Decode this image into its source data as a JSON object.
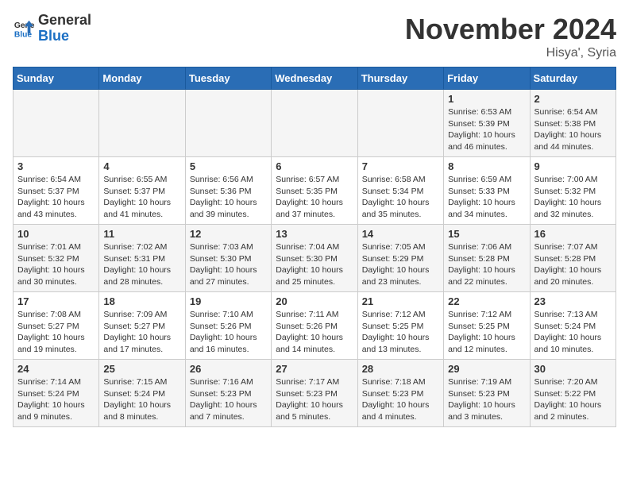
{
  "header": {
    "logo_line1": "General",
    "logo_line2": "Blue",
    "month": "November 2024",
    "location": "Hisya', Syria"
  },
  "days_of_week": [
    "Sunday",
    "Monday",
    "Tuesday",
    "Wednesday",
    "Thursday",
    "Friday",
    "Saturday"
  ],
  "weeks": [
    [
      {
        "day": "",
        "info": ""
      },
      {
        "day": "",
        "info": ""
      },
      {
        "day": "",
        "info": ""
      },
      {
        "day": "",
        "info": ""
      },
      {
        "day": "",
        "info": ""
      },
      {
        "day": "1",
        "info": "Sunrise: 6:53 AM\nSunset: 5:39 PM\nDaylight: 10 hours and 46 minutes."
      },
      {
        "day": "2",
        "info": "Sunrise: 6:54 AM\nSunset: 5:38 PM\nDaylight: 10 hours and 44 minutes."
      }
    ],
    [
      {
        "day": "3",
        "info": "Sunrise: 6:54 AM\nSunset: 5:37 PM\nDaylight: 10 hours and 43 minutes."
      },
      {
        "day": "4",
        "info": "Sunrise: 6:55 AM\nSunset: 5:37 PM\nDaylight: 10 hours and 41 minutes."
      },
      {
        "day": "5",
        "info": "Sunrise: 6:56 AM\nSunset: 5:36 PM\nDaylight: 10 hours and 39 minutes."
      },
      {
        "day": "6",
        "info": "Sunrise: 6:57 AM\nSunset: 5:35 PM\nDaylight: 10 hours and 37 minutes."
      },
      {
        "day": "7",
        "info": "Sunrise: 6:58 AM\nSunset: 5:34 PM\nDaylight: 10 hours and 35 minutes."
      },
      {
        "day": "8",
        "info": "Sunrise: 6:59 AM\nSunset: 5:33 PM\nDaylight: 10 hours and 34 minutes."
      },
      {
        "day": "9",
        "info": "Sunrise: 7:00 AM\nSunset: 5:32 PM\nDaylight: 10 hours and 32 minutes."
      }
    ],
    [
      {
        "day": "10",
        "info": "Sunrise: 7:01 AM\nSunset: 5:32 PM\nDaylight: 10 hours and 30 minutes."
      },
      {
        "day": "11",
        "info": "Sunrise: 7:02 AM\nSunset: 5:31 PM\nDaylight: 10 hours and 28 minutes."
      },
      {
        "day": "12",
        "info": "Sunrise: 7:03 AM\nSunset: 5:30 PM\nDaylight: 10 hours and 27 minutes."
      },
      {
        "day": "13",
        "info": "Sunrise: 7:04 AM\nSunset: 5:30 PM\nDaylight: 10 hours and 25 minutes."
      },
      {
        "day": "14",
        "info": "Sunrise: 7:05 AM\nSunset: 5:29 PM\nDaylight: 10 hours and 23 minutes."
      },
      {
        "day": "15",
        "info": "Sunrise: 7:06 AM\nSunset: 5:28 PM\nDaylight: 10 hours and 22 minutes."
      },
      {
        "day": "16",
        "info": "Sunrise: 7:07 AM\nSunset: 5:28 PM\nDaylight: 10 hours and 20 minutes."
      }
    ],
    [
      {
        "day": "17",
        "info": "Sunrise: 7:08 AM\nSunset: 5:27 PM\nDaylight: 10 hours and 19 minutes."
      },
      {
        "day": "18",
        "info": "Sunrise: 7:09 AM\nSunset: 5:27 PM\nDaylight: 10 hours and 17 minutes."
      },
      {
        "day": "19",
        "info": "Sunrise: 7:10 AM\nSunset: 5:26 PM\nDaylight: 10 hours and 16 minutes."
      },
      {
        "day": "20",
        "info": "Sunrise: 7:11 AM\nSunset: 5:26 PM\nDaylight: 10 hours and 14 minutes."
      },
      {
        "day": "21",
        "info": "Sunrise: 7:12 AM\nSunset: 5:25 PM\nDaylight: 10 hours and 13 minutes."
      },
      {
        "day": "22",
        "info": "Sunrise: 7:12 AM\nSunset: 5:25 PM\nDaylight: 10 hours and 12 minutes."
      },
      {
        "day": "23",
        "info": "Sunrise: 7:13 AM\nSunset: 5:24 PM\nDaylight: 10 hours and 10 minutes."
      }
    ],
    [
      {
        "day": "24",
        "info": "Sunrise: 7:14 AM\nSunset: 5:24 PM\nDaylight: 10 hours and 9 minutes."
      },
      {
        "day": "25",
        "info": "Sunrise: 7:15 AM\nSunset: 5:24 PM\nDaylight: 10 hours and 8 minutes."
      },
      {
        "day": "26",
        "info": "Sunrise: 7:16 AM\nSunset: 5:23 PM\nDaylight: 10 hours and 7 minutes."
      },
      {
        "day": "27",
        "info": "Sunrise: 7:17 AM\nSunset: 5:23 PM\nDaylight: 10 hours and 5 minutes."
      },
      {
        "day": "28",
        "info": "Sunrise: 7:18 AM\nSunset: 5:23 PM\nDaylight: 10 hours and 4 minutes."
      },
      {
        "day": "29",
        "info": "Sunrise: 7:19 AM\nSunset: 5:23 PM\nDaylight: 10 hours and 3 minutes."
      },
      {
        "day": "30",
        "info": "Sunrise: 7:20 AM\nSunset: 5:22 PM\nDaylight: 10 hours and 2 minutes."
      }
    ]
  ]
}
